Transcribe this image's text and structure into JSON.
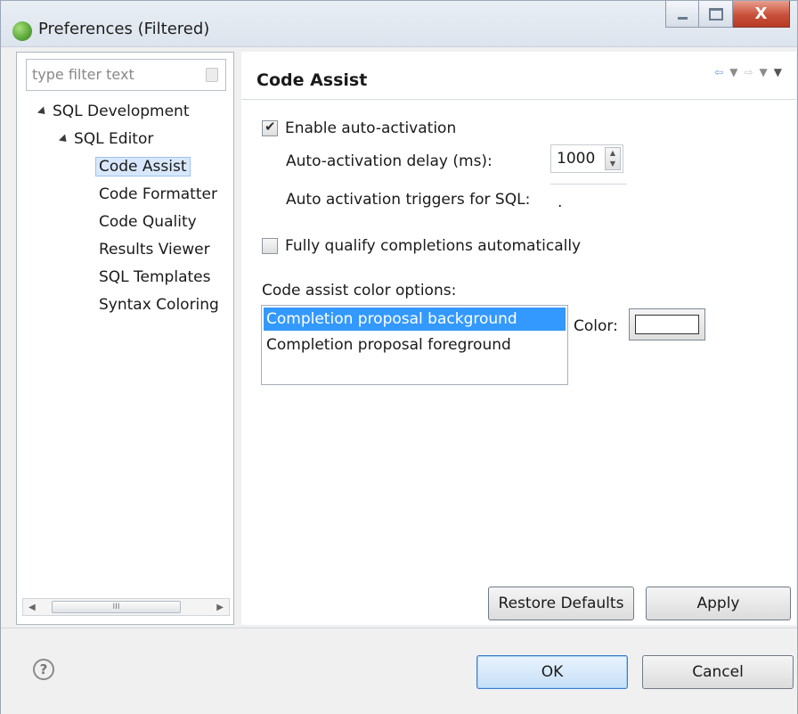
{
  "window": {
    "title": "Preferences (Filtered)",
    "close_glyph": "X"
  },
  "sidebar": {
    "filter_placeholder": "type filter text",
    "tree": [
      {
        "label": "SQL Development",
        "level": 0,
        "expanded": true
      },
      {
        "label": "SQL Editor",
        "level": 1,
        "expanded": true
      },
      {
        "label": "Code Assist",
        "level": 2,
        "selected": true
      },
      {
        "label": "Code Formatter",
        "level": 2
      },
      {
        "label": "Code Quality",
        "level": 2
      },
      {
        "label": "Results Viewer",
        "level": 2
      },
      {
        "label": "SQL Templates",
        "level": 2
      },
      {
        "label": "Syntax Coloring",
        "level": 2
      }
    ],
    "scrollbar_grip": "III"
  },
  "page": {
    "title": "Code Assist",
    "enable_auto_activation": {
      "label": "Enable auto-activation",
      "checked": true
    },
    "delay": {
      "label": "Auto-activation delay (ms):",
      "value": "1000"
    },
    "triggers": {
      "label": "Auto activation triggers for SQL:",
      "value": "."
    },
    "fully_qualify": {
      "label": "Fully qualify completions automatically",
      "checked": false
    },
    "color_options_label": "Code assist color options:",
    "color_options": [
      "Completion proposal background",
      "Completion proposal foreground"
    ],
    "color_label": "Color:",
    "selected_color": "#ffffff",
    "restore_defaults": "Restore Defaults",
    "apply": "Apply"
  },
  "footer": {
    "help_glyph": "?",
    "ok": "OK",
    "cancel": "Cancel"
  },
  "colors": {
    "selection": "#3399ff",
    "title_bar": "#dde4ed",
    "close_button": "#c8503a"
  }
}
